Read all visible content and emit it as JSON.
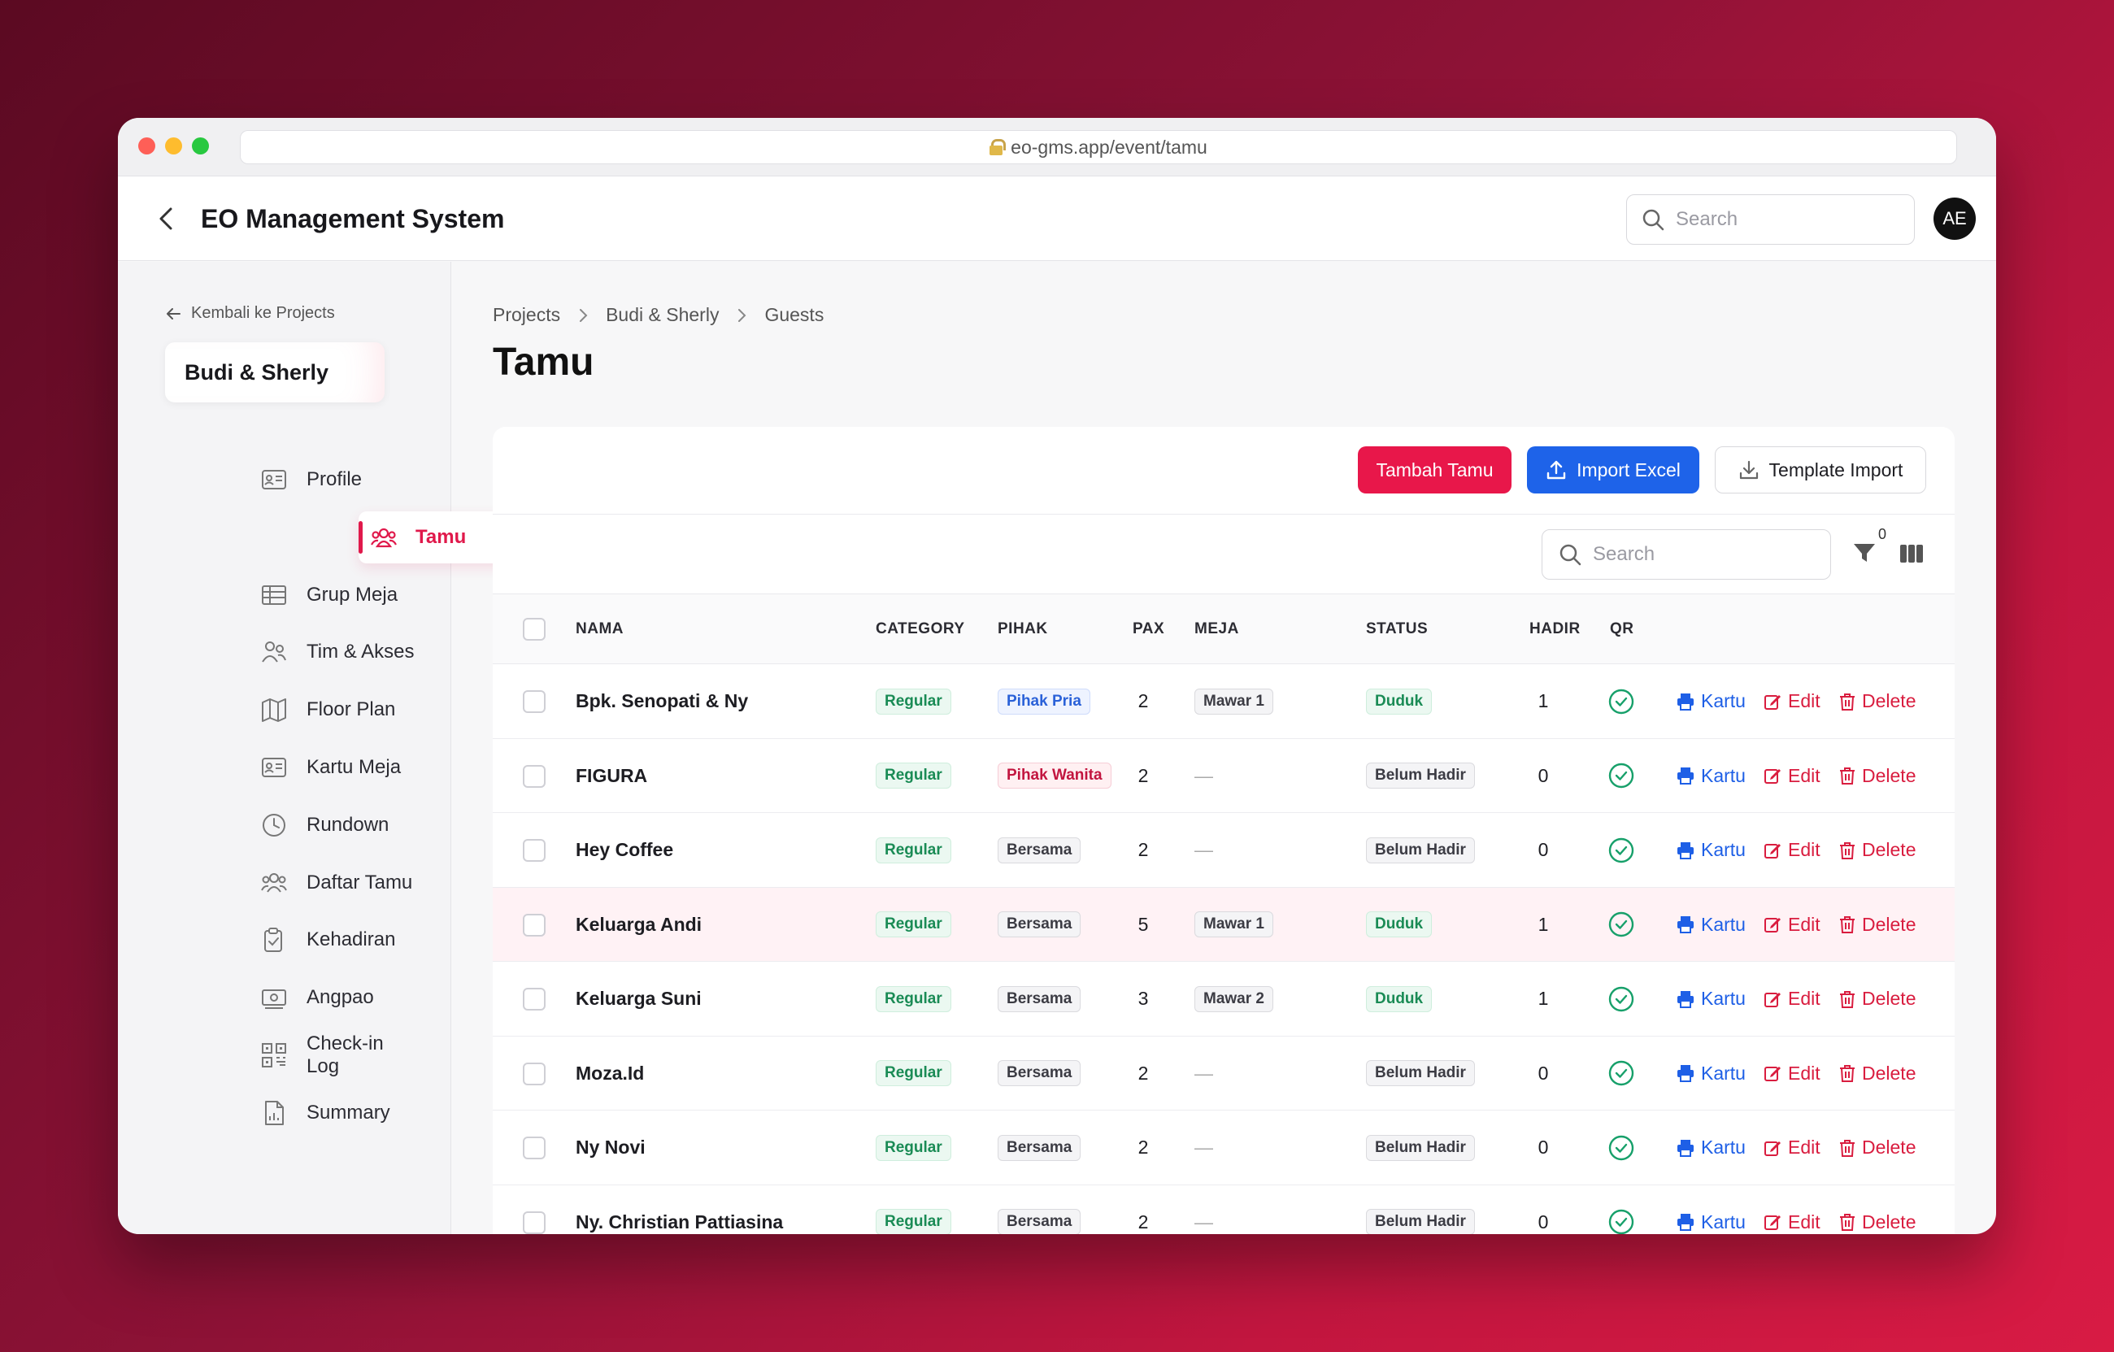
{
  "browser": {
    "url": "eo-gms.app/event/tamu"
  },
  "app": {
    "title": "EO Management System",
    "search_placeholder": "Search",
    "avatar_initials": "AE"
  },
  "sidebar": {
    "back_label": "Kembali ke Projects",
    "project_name": "Budi & Sherly",
    "items": [
      {
        "label": "Profile",
        "icon": "id-card-icon"
      },
      {
        "label": "Tamu",
        "icon": "users-icon",
        "active": true
      },
      {
        "label": "Grup Meja",
        "icon": "table-grid-icon"
      },
      {
        "label": "Tim & Akses",
        "icon": "team-icon"
      },
      {
        "label": "Floor Plan",
        "icon": "map-icon"
      },
      {
        "label": "Kartu Meja",
        "icon": "card-icon"
      },
      {
        "label": "Rundown",
        "icon": "clock-icon"
      },
      {
        "label": "Daftar Tamu",
        "icon": "guest-list-icon"
      },
      {
        "label": "Kehadiran",
        "icon": "clipboard-check-icon"
      },
      {
        "label": "Angpao",
        "icon": "money-icon"
      },
      {
        "label": "Check-in Log",
        "icon": "qr-icon"
      },
      {
        "label": "Summary",
        "icon": "document-icon"
      }
    ]
  },
  "breadcrumb": [
    "Projects",
    "Budi & Sherly",
    "Guests"
  ],
  "page_title": "Tamu",
  "toolbar": {
    "add_label": "Tambah Tamu",
    "import_label": "Import Excel",
    "template_label": "Template Import"
  },
  "filter": {
    "search_placeholder": "Search",
    "filter_count": "0"
  },
  "colors": {
    "accent": "#e8174a",
    "primary": "#1e63e9"
  },
  "table": {
    "headers": {
      "nama": "NAMA",
      "category": "CATEGORY",
      "pihak": "PIHAK",
      "pax": "PAX",
      "meja": "MEJA",
      "status": "STATUS",
      "hadir": "HADIR",
      "qr": "QR"
    },
    "actions": {
      "kartu": "Kartu",
      "edit": "Edit",
      "delete": "Delete"
    },
    "rows": [
      {
        "nama": "Bpk. Senopati & Ny",
        "category": "Regular",
        "pihak": "Pihak Pria",
        "pihak_type": "blue",
        "pax": "2",
        "meja": "Mawar 1",
        "status": "Duduk",
        "status_type": "green",
        "hadir": "1"
      },
      {
        "nama": "FIGURA",
        "category": "Regular",
        "pihak": "Pihak Wanita",
        "pihak_type": "red",
        "pax": "2",
        "meja": "—",
        "status": "Belum Hadir",
        "status_type": "gray",
        "hadir": "0"
      },
      {
        "nama": "Hey Coffee",
        "category": "Regular",
        "pihak": "Bersama",
        "pihak_type": "gray",
        "pax": "2",
        "meja": "—",
        "status": "Belum Hadir",
        "status_type": "gray",
        "hadir": "0"
      },
      {
        "nama": "Keluarga Andi",
        "category": "Regular",
        "pihak": "Bersama",
        "pihak_type": "gray",
        "pax": "5",
        "meja": "Mawar 1",
        "status": "Duduk",
        "status_type": "green",
        "hadir": "1",
        "highlight": true
      },
      {
        "nama": "Keluarga Suni",
        "category": "Regular",
        "pihak": "Bersama",
        "pihak_type": "gray",
        "pax": "3",
        "meja": "Mawar 2",
        "status": "Duduk",
        "status_type": "green",
        "hadir": "1"
      },
      {
        "nama": "Moza.Id",
        "category": "Regular",
        "pihak": "Bersama",
        "pihak_type": "gray",
        "pax": "2",
        "meja": "—",
        "status": "Belum Hadir",
        "status_type": "gray",
        "hadir": "0"
      },
      {
        "nama": "Ny Novi",
        "category": "Regular",
        "pihak": "Bersama",
        "pihak_type": "gray",
        "pax": "2",
        "meja": "—",
        "status": "Belum Hadir",
        "status_type": "gray",
        "hadir": "0"
      },
      {
        "nama": "Ny. Christian Pattiasina",
        "category": "Regular",
        "pihak": "Bersama",
        "pihak_type": "gray",
        "pax": "2",
        "meja": "—",
        "status": "Belum Hadir",
        "status_type": "gray",
        "hadir": "0"
      }
    ]
  }
}
